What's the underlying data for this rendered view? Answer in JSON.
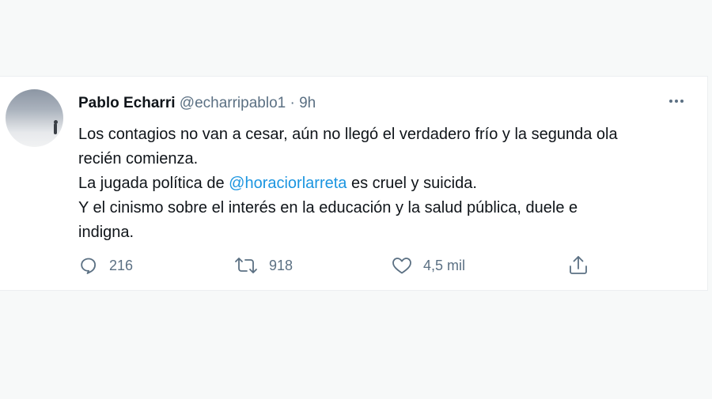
{
  "tweet": {
    "author_name": "Pablo Echarri",
    "handle": "@echarripablo1",
    "separator": "·",
    "time": "9h",
    "lines": {
      "l1": "Los contagios no van a cesar, aún no llegó el verdadero frío y la segunda ola",
      "l2": "recién comienza.",
      "l3_pre": "La jugada política de ",
      "l3_mention": "@horaciorlarreta",
      "l3_post": " es cruel y suicida.",
      "l4": "Y el cinismo sobre el interés en la educación y la salud pública, duele e",
      "l5": "indigna."
    },
    "actions": {
      "replies": "216",
      "retweets": "918",
      "likes": "4,5 mil"
    }
  },
  "colors": {
    "background": "#f7f9f9",
    "card": "#ffffff",
    "text": "#0f1419",
    "secondary": "#5b7083",
    "link": "#1b95e0"
  },
  "icons": [
    "more-icon",
    "reply-icon",
    "retweet-icon",
    "like-icon",
    "share-icon"
  ]
}
